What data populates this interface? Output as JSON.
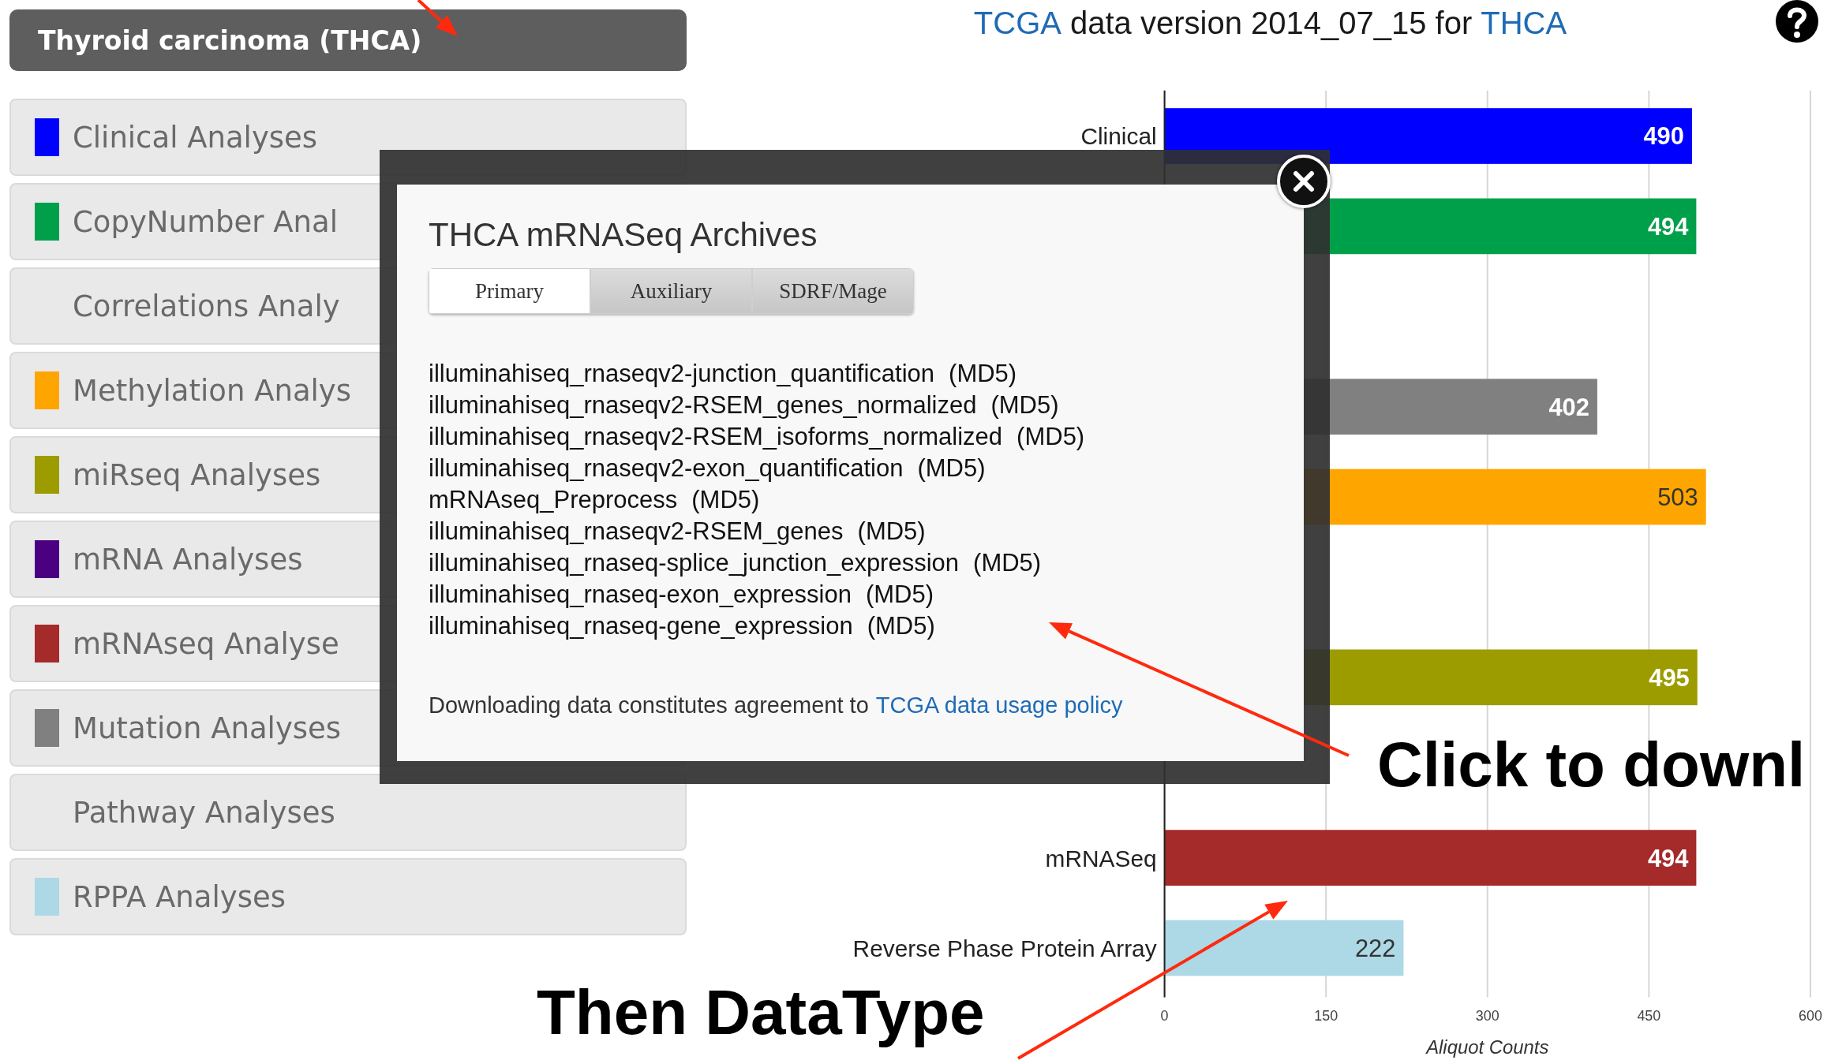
{
  "sidebar": {
    "header": "Thyroid carcinoma (THCA)",
    "items": [
      {
        "label": "Clinical Analyses",
        "color": "#0000ff"
      },
      {
        "label": "CopyNumber Anal",
        "color": "#00a04a"
      },
      {
        "label": "Correlations Analy"
      },
      {
        "label": "Methylation Analys",
        "color": "#ffa500"
      },
      {
        "label": "miRseq Analyses",
        "color": "#9c9c00"
      },
      {
        "label": "mRNA Analyses",
        "color": "#4b0082"
      },
      {
        "label": "mRNAseq Analyse",
        "color": "#a52a2a"
      },
      {
        "label": "Mutation Analyses",
        "color": "#808080"
      },
      {
        "label": "Pathway Analyses"
      },
      {
        "label": "RPPA Analyses",
        "color": "#add8e6"
      }
    ]
  },
  "title": {
    "source_link": "TCGA",
    "text": "data version 2014_07_15 for",
    "disease_link": "THCA"
  },
  "chart": {
    "chart_data": {
      "type": "bar",
      "orientation": "horizontal",
      "xlabel": "Aliquot Counts",
      "categories": [
        "Clinical",
        null,
        null,
        null,
        null,
        null,
        null,
        null,
        "mRNASeq",
        "Reverse Phase Protein Array"
      ],
      "series": [
        {
          "values": [
            490,
            494,
            null,
            402,
            503,
            null,
            495,
            null,
            494,
            222
          ]
        }
      ],
      "colors": [
        "#0000ff",
        "#00a04a",
        null,
        "#808080",
        "#ffa500",
        null,
        "#9c9c00",
        null,
        "#a52a2a",
        "#add8e6"
      ],
      "xlim": [
        0,
        600
      ],
      "xticks": [
        0,
        150,
        300,
        450,
        600
      ],
      "data_labels": true,
      "grid": true
    }
  },
  "dialog": {
    "title": "THCA mRNASeq Archives",
    "tabs": [
      {
        "label": "Primary",
        "selected": true
      },
      {
        "label": "Auxiliary",
        "selected": false
      },
      {
        "label": "SDRF/Mage",
        "selected": false
      }
    ],
    "archives": [
      {
        "name": "illuminahiseq_rnaseqv2-junction_quantification",
        "checksum": "(MD5)"
      },
      {
        "name": "illuminahiseq_rnaseqv2-RSEM_genes_normalized",
        "checksum": "(MD5)"
      },
      {
        "name": "illuminahiseq_rnaseqv2-RSEM_isoforms_normalized",
        "checksum": "(MD5)"
      },
      {
        "name": "illuminahiseq_rnaseqv2-exon_quantification",
        "checksum": "(MD5)"
      },
      {
        "name": "mRNAseq_Preprocess",
        "checksum": "(MD5)"
      },
      {
        "name": "illuminahiseq_rnaseqv2-RSEM_genes",
        "checksum": "(MD5)"
      },
      {
        "name": "illuminahiseq_rnaseq-splice_junction_expression",
        "checksum": "(MD5)"
      },
      {
        "name": "illuminahiseq_rnaseq-exon_expression",
        "checksum": "(MD5)"
      },
      {
        "name": "illuminahiseq_rnaseq-gene_expression",
        "checksum": "(MD5)"
      }
    ],
    "notice": "Downloading data constitutes agreement to",
    "policy_link": "TCGA data usage policy"
  },
  "annotations": {
    "download_hint": "Click to downl",
    "datatype_hint": "Then DataType"
  }
}
